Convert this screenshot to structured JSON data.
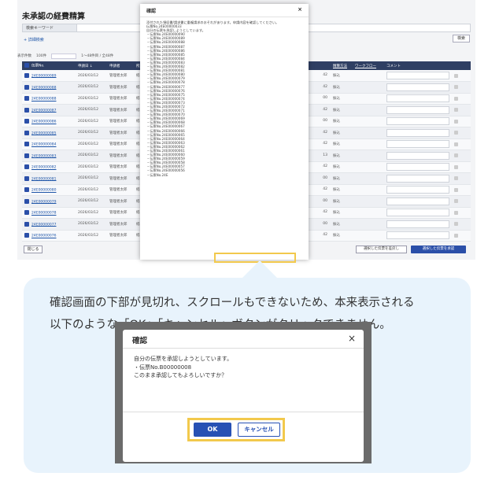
{
  "page": {
    "title": "未承認の経費精算",
    "keyword_label": "検索キーワード",
    "advanced_search": "+ 詳細検索",
    "search_button": "検索",
    "count_label": "表示件数",
    "count_value": "100件",
    "range_text": "1〜48件目 / 全48件"
  },
  "table": {
    "headers": [
      "伝票No.",
      "申請日 ↓",
      "申請者",
      "所属部門",
      "精算方法",
      "ワークフロー",
      "コメント"
    ],
    "rows": [
      {
        "id": "24E00000089",
        "date": "2026/03/12",
        "user": "管理者太郎",
        "dept": "経理部(20",
        "method": "振込",
        "amt": "42"
      },
      {
        "id": "24E00000088",
        "date": "2026/03/12",
        "user": "管理者太郎",
        "dept": "経理部(20",
        "method": "振込",
        "amt": "42"
      },
      {
        "id": "24E00000088",
        "date": "2026/03/12",
        "user": "管理者太郎",
        "dept": "経理部(20",
        "method": "振込",
        "amt": "00"
      },
      {
        "id": "24E00000087",
        "date": "2026/03/12",
        "user": "管理者太郎",
        "dept": "経理部(20",
        "method": "振込",
        "amt": "42"
      },
      {
        "id": "24E00000086",
        "date": "2026/03/12",
        "user": "管理者太郎",
        "dept": "経理部(20",
        "method": "振込",
        "amt": "00"
      },
      {
        "id": "24E00000085",
        "date": "2026/03/12",
        "user": "管理者太郎",
        "dept": "経理部(20",
        "method": "振込",
        "amt": "42"
      },
      {
        "id": "24E00000084",
        "date": "2026/03/12",
        "user": "管理者太郎",
        "dept": "経理部(20",
        "method": "振込",
        "amt": "42"
      },
      {
        "id": "24E00000083",
        "date": "2026/03/12",
        "user": "管理者太郎",
        "dept": "経理部(20",
        "method": "振込",
        "amt": "13"
      },
      {
        "id": "24E00000082",
        "date": "2026/03/12",
        "user": "管理者太郎",
        "dept": "経理部(20",
        "method": "振込",
        "amt": "42"
      },
      {
        "id": "24E00000081",
        "date": "2026/03/12",
        "user": "管理者太郎",
        "dept": "経理部(20",
        "method": "振込",
        "amt": "00"
      },
      {
        "id": "24E00000080",
        "date": "2026/03/12",
        "user": "管理者太郎",
        "dept": "経理部(20",
        "method": "振込",
        "amt": "42"
      },
      {
        "id": "24E00000079",
        "date": "2026/03/12",
        "user": "管理者太郎",
        "dept": "経理部(20",
        "method": "振込",
        "amt": "00"
      },
      {
        "id": "24E00000078",
        "date": "2026/03/12",
        "user": "管理者太郎",
        "dept": "経理部(20",
        "method": "振込",
        "amt": "42"
      },
      {
        "id": "24E00000077",
        "date": "2026/03/12",
        "user": "管理者太郎",
        "dept": "経理部(20",
        "method": "振込",
        "amt": "00"
      },
      {
        "id": "24E00000076",
        "date": "2026/03/12",
        "user": "管理者太郎",
        "dept": "経理部(20",
        "method": "振込",
        "amt": "42"
      }
    ],
    "close_button": "閉じる",
    "deny_button": "選択した伝票を差戻し",
    "approve_button": "選択した伝票を承認"
  },
  "dialog": {
    "title": "確認",
    "close": "×",
    "lines": [
      "添付された領収書/請求書に重複請求のおそれがあります。申請内容を確認してください。",
      "伝票No.24E00000033",
      "自分の伝票を承認しようとしています。",
      "・伝票No.24E00000090",
      "・伝票No.24E00000089",
      "・伝票No.24E00000088",
      "・伝票No.24E00000087",
      "・伝票No.24E00000086",
      "・伝票No.24E00000085",
      "・伝票No.24E00000084",
      "・伝票No.24E00000083",
      "・伝票No.24E00000082",
      "・伝票No.24E00000081",
      "・伝票No.24E00000080",
      "・伝票No.24E00000079",
      "・伝票No.24E00000078",
      "・伝票No.24E00000077",
      "・伝票No.24E00000076",
      "・伝票No.24E00000075",
      "・伝票No.24E00000074",
      "・伝票No.24E00000073",
      "・伝票No.24E00000072",
      "・伝票No.24E00000071",
      "・伝票No.24E00000070",
      "・伝票No.24E00000069",
      "・伝票No.24E00000068",
      "・伝票No.24E00000067",
      "・伝票No.24E00000066",
      "・伝票No.24E00000065",
      "・伝票No.24E00000064",
      "・伝票No.24E00000063",
      "・伝票No.24E00000062",
      "・伝票No.24E00000061",
      "・伝票No.24E00000060",
      "・伝票No.24E00000059",
      "・伝票No.24E00000058",
      "・伝票No.24E00000057",
      "・伝票No.24E00000056",
      "・伝票No.24E"
    ]
  },
  "note": {
    "line1": "確認画面の下部が見切れ、スクロールもできないため、本来表示される",
    "line2": "以下のような「OK」「キャンセル」ボタンがクリックできません。"
  },
  "example_dialog": {
    "title": "確認",
    "close": "×",
    "msg1": "自分の伝票を承認しようとしています。",
    "msg2": "・伝票No.B00000008",
    "msg3": "このまま承認してもよろしいですか？",
    "ok": "OK",
    "cancel": "キャンセル"
  },
  "colors": {
    "header": "#2f3f63",
    "primary": "#2751b4",
    "highlight": "#f2c94c",
    "bubble": "#e8f3fc"
  }
}
